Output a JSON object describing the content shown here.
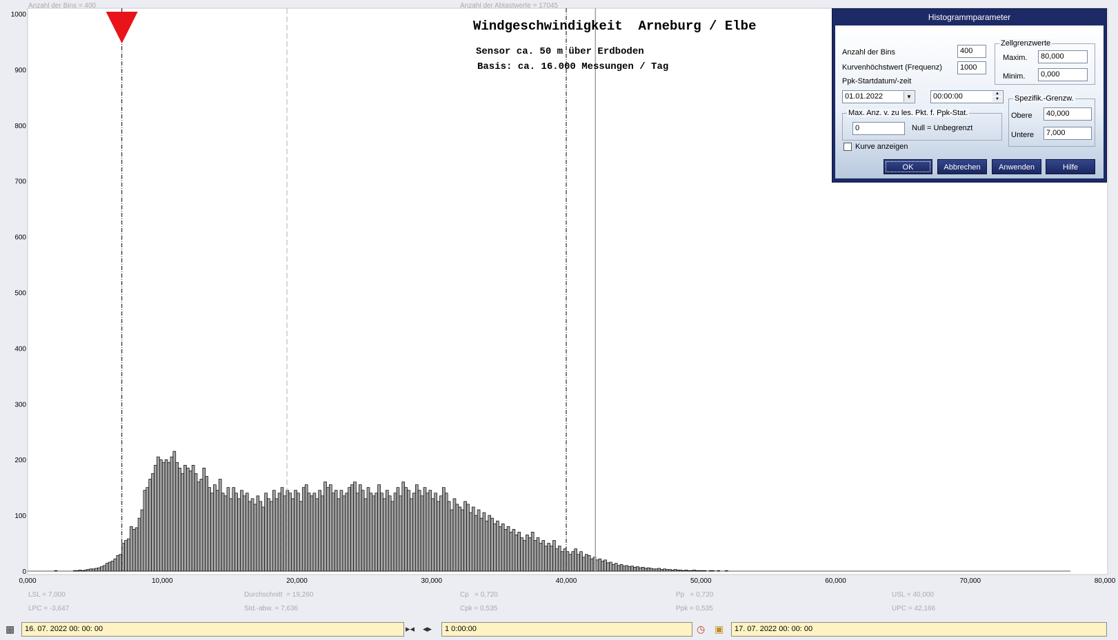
{
  "header": {
    "bins_label": "Anzahl der Bins =   400",
    "samples_label": "Anzahl der Abtastwerte = 17045"
  },
  "chart_data": {
    "type": "bar",
    "title": "Windgeschwindigkeit  Arneburg / Elbe",
    "subtitle_lines": [
      "Sensor ca. 50 m über Erdboden",
      "Basis: ca. 16.000 Messungen / Tag"
    ],
    "x_range": [
      0,
      80
    ],
    "y_range": [
      0,
      1000
    ],
    "bin_width": 0.2,
    "x_ticks": [
      "0,000",
      "10,000",
      "20,000",
      "30,000",
      "40,000",
      "50,000",
      "60,000",
      "70,000",
      "80,000"
    ],
    "y_ticks": [
      "0",
      "100",
      "200",
      "300",
      "400",
      "500",
      "600",
      "700",
      "800",
      "900",
      "1000"
    ],
    "reference_lines": {
      "lsl": 7.0,
      "mean": 19.26,
      "usl": 40.0,
      "upc": 42.166
    },
    "marker": {
      "value": 7.0,
      "color": "#e8141a"
    },
    "bar_fill": "#a3a3a3",
    "bar_stroke": "#000000",
    "histogram": {
      "x_start": 2.0,
      "values": [
        1,
        0,
        0,
        0,
        0,
        0,
        0,
        1,
        1,
        2,
        1,
        2,
        3,
        4,
        4,
        5,
        6,
        8,
        10,
        14,
        16,
        18,
        22,
        28,
        30,
        50,
        55,
        58,
        80,
        75,
        78,
        95,
        110,
        145,
        150,
        165,
        175,
        190,
        205,
        200,
        195,
        200,
        195,
        205,
        215,
        195,
        185,
        175,
        190,
        185,
        180,
        190,
        175,
        160,
        165,
        185,
        170,
        150,
        140,
        155,
        145,
        165,
        140,
        135,
        150,
        130,
        150,
        140,
        130,
        145,
        135,
        140,
        125,
        130,
        120,
        135,
        125,
        115,
        140,
        130,
        125,
        145,
        130,
        140,
        150,
        135,
        145,
        140,
        130,
        145,
        140,
        125,
        150,
        155,
        140,
        135,
        140,
        130,
        145,
        135,
        160,
        150,
        155,
        140,
        145,
        130,
        145,
        135,
        140,
        150,
        155,
        160,
        140,
        155,
        145,
        130,
        150,
        140,
        135,
        140,
        155,
        140,
        130,
        145,
        135,
        125,
        140,
        150,
        135,
        160,
        150,
        145,
        130,
        140,
        155,
        145,
        135,
        150,
        140,
        145,
        130,
        140,
        125,
        135,
        150,
        140,
        125,
        110,
        130,
        120,
        115,
        110,
        125,
        120,
        105,
        115,
        100,
        110,
        95,
        105,
        90,
        100,
        95,
        85,
        90,
        80,
        85,
        75,
        80,
        70,
        75,
        65,
        70,
        60,
        55,
        65,
        60,
        70,
        55,
        60,
        50,
        55,
        45,
        50,
        45,
        55,
        40,
        45,
        35,
        40,
        35,
        30,
        35,
        40,
        30,
        35,
        25,
        30,
        28,
        22,
        25,
        20,
        22,
        18,
        20,
        15,
        16,
        12,
        14,
        10,
        12,
        9,
        10,
        8,
        9,
        7,
        8,
        6,
        7,
        5,
        6,
        5,
        4,
        4,
        5,
        3,
        4,
        3,
        3,
        2,
        3,
        2,
        2,
        1,
        2,
        1,
        1,
        2,
        1,
        1,
        1,
        1,
        0,
        1,
        1,
        0,
        1,
        0,
        0,
        1
      ]
    }
  },
  "stats": {
    "lsl": "LSL = 7,000",
    "lpc": "LPC = -3,647",
    "mean": "Durchschnitt  = 19,260",
    "std": "Std.-abw. = 7,636",
    "cp": "Cp   = 0,720",
    "cpk": "Cpk = 0,535",
    "pp": "Pp   = 0,720",
    "ppk": "Ppk = 0,535",
    "usl": "USL = 40,000",
    "upc": "UPC = 42,166"
  },
  "dialog": {
    "title": "Histogrammparameter",
    "bins_label": "Anzahl der Bins",
    "bins_value": "400",
    "max_freq_label": "Kurvenhöchstwert (Frequenz)",
    "max_freq_value": "1000",
    "ppk_start_label": "Ppk-Startdatum/-zeit",
    "date_value": "01.01.2022",
    "time_value": "00:00:00",
    "cell_group_title": "Zellgrenzwerte",
    "max_label": "Maxim.",
    "max_value": "80,000",
    "min_label": "Minim.",
    "min_value": "0,000",
    "points_group_title": "Max. Anz. v. zu les. Pkt. f. Ppk-Stat.",
    "points_value": "0",
    "points_hint": "Null = Unbegrenzt",
    "spec_group_title": "Spezifik.-Grenzw.",
    "upper_label": "Obere",
    "upper_value": "40,000",
    "lower_label": "Untere",
    "lower_value": "7,000",
    "show_curve_label": "Kurve anzeigen",
    "ok_label": "OK",
    "cancel_label": "Abbrechen",
    "apply_label": "Anwenden",
    "help_label": "Hilfe"
  },
  "bottombar": {
    "start_datetime": "16. 07. 2022   00: 00: 00",
    "interval": "1 0:00:00",
    "end_datetime": "17. 07. 2022   00: 00: 00"
  }
}
